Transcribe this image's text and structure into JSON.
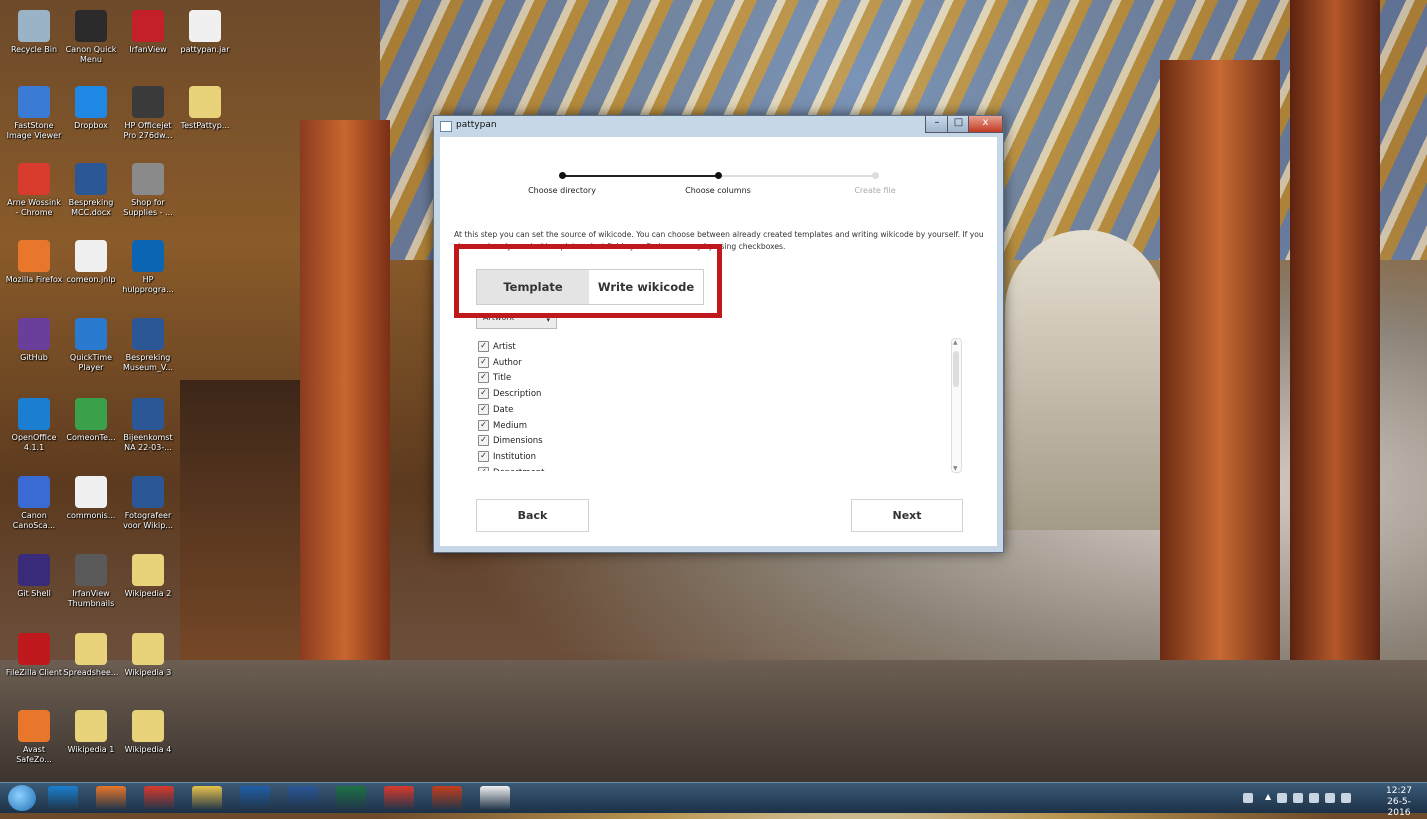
{
  "desktop_icons": [
    {
      "label": "Recycle Bin",
      "color": "#9bb3c6"
    },
    {
      "label": "Canon Quick Menu",
      "color": "#2b2b2b"
    },
    {
      "label": "IrfanView",
      "color": "#c3202a"
    },
    {
      "label": "pattypan.jar",
      "color": "#f0f0f0"
    },
    {
      "label": "FastStone Image Viewer",
      "color": "#3a7bd5"
    },
    {
      "label": "Dropbox",
      "color": "#1f88e5"
    },
    {
      "label": "HP Officejet Pro 276dw...",
      "color": "#3a3a3a"
    },
    {
      "label": "TestPattyp...",
      "color": "#e8d37a"
    },
    {
      "label": "Arne Wossink - Chrome",
      "color": "#d83a2c"
    },
    {
      "label": "Bespreking MCC.docx",
      "color": "#2b5797"
    },
    {
      "label": "Shop for Supplies - ...",
      "color": "#8a8a8a"
    },
    {
      "label": "Mozilla Firefox",
      "color": "#e8762b"
    },
    {
      "label": "comeon.jnlp",
      "color": "#f0f0f0"
    },
    {
      "label": "HP hulpprogra...",
      "color": "#0b65b3"
    },
    {
      "label": "GitHub",
      "color": "#6a3f9c"
    },
    {
      "label": "QuickTime Player",
      "color": "#2a7ad0"
    },
    {
      "label": "Bespreking Museum_V...",
      "color": "#2b5797"
    },
    {
      "label": "OpenOffice 4.1.1",
      "color": "#1a7fd0"
    },
    {
      "label": "ComeonTe...",
      "color": "#3aa14a"
    },
    {
      "label": "Bijeenkomst NA 22-03-...",
      "color": "#2b5797"
    },
    {
      "label": "Canon CanoSca...",
      "color": "#3a6bd5"
    },
    {
      "label": "commonis...",
      "color": "#f0f0f0"
    },
    {
      "label": "Fotografeer voor Wikip...",
      "color": "#2b5797"
    },
    {
      "label": "Git Shell",
      "color": "#3a2a7a"
    },
    {
      "label": "IrfanView Thumbnails",
      "color": "#5a5a5a"
    },
    {
      "label": "Wikipedia 2",
      "color": "#e8d37a"
    },
    {
      "label": "FileZilla Client",
      "color": "#c0191d"
    },
    {
      "label": "Spreadshee...",
      "color": "#e8d37a"
    },
    {
      "label": "Wikipedia 3",
      "color": "#e8d37a"
    },
    {
      "label": "Avast SafeZo...",
      "color": "#e8762b"
    },
    {
      "label": "Wikipedia 1",
      "color": "#e8d37a"
    },
    {
      "label": "Wikipedia 4",
      "color": "#e8d37a"
    }
  ],
  "window": {
    "title": "pattypan",
    "controls": {
      "minimize": "–",
      "maximize": "□",
      "close": "x"
    }
  },
  "stepper": [
    {
      "label": "Choose directory",
      "state": "done"
    },
    {
      "label": "Choose columns",
      "state": "current"
    },
    {
      "label": "Create file",
      "state": "pending"
    }
  ],
  "description": "At this step you can set the source of wikicode. You can choose between already created templates and writing wikicode by yourself. If you choose already created template select fields you find necessary by using checkboxes.",
  "tabs": [
    {
      "label": "Template",
      "selected": true
    },
    {
      "label": "Write wikicode",
      "selected": false
    }
  ],
  "template_select": {
    "value": "Artwork"
  },
  "fields": [
    {
      "label": "Artist",
      "checked": true
    },
    {
      "label": "Author",
      "checked": true
    },
    {
      "label": "Title",
      "checked": true
    },
    {
      "label": "Description",
      "checked": true
    },
    {
      "label": "Date",
      "checked": true
    },
    {
      "label": "Medium",
      "checked": true
    },
    {
      "label": "Dimensions",
      "checked": true
    },
    {
      "label": "Institution",
      "checked": true
    },
    {
      "label": "Department",
      "checked": true
    }
  ],
  "buttons": {
    "back": "Back",
    "next": "Next"
  },
  "taskbar": {
    "time": "12:27",
    "date": "26-5-2016",
    "pinned": [
      "internet-explorer",
      "firefox",
      "chrome",
      "file-explorer",
      "media-player",
      "word",
      "excel",
      "chrome-2",
      "powerpoint",
      "java"
    ]
  },
  "colors": {
    "highlight": "#c0191d",
    "accent": "#222222",
    "inactive": "#cccccc"
  }
}
